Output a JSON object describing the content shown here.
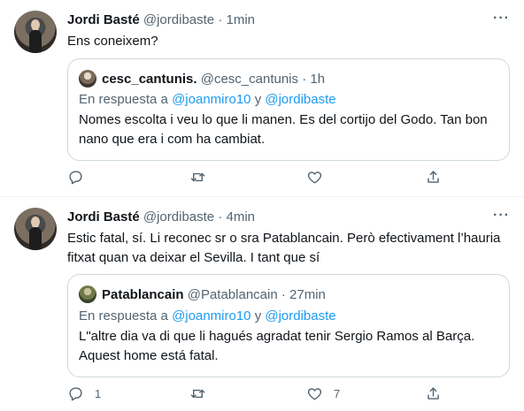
{
  "tweets": [
    {
      "name": "Jordi Basté",
      "handle": "@jordibaste",
      "sep": "·",
      "time": "1min",
      "text": "Ens coneixem?",
      "more": "···",
      "quote": {
        "name": "cesc_cantunis.",
        "handle": "@cesc_cantunis",
        "sep": "·",
        "time": "1h",
        "reply_prefix": "En respuesta a",
        "reply_user1": "@joanmiro10",
        "reply_and": "y",
        "reply_user2": "@jordibaste",
        "text": "Nomes escolta i veu lo que li manen. Es del cortijo del Godo. Tan bon nano que era i com ha cambiat."
      },
      "actions": {
        "reply_count": "",
        "retweet_count": "",
        "like_count": ""
      }
    },
    {
      "name": "Jordi Basté",
      "handle": "@jordibaste",
      "sep": "·",
      "time": "4min",
      "text": "Estic fatal, sí. Li reconec sr o sra Patablancain. Però efectivament l’hauria fitxat quan va deixar el Sevilla. I tant que sí",
      "more": "···",
      "quote": {
        "name": "Patablancain",
        "handle": "@Patablancain",
        "sep": "·",
        "time": "27min",
        "reply_prefix": "En respuesta a",
        "reply_user1": "@joanmiro10",
        "reply_and": "y",
        "reply_user2": "@jordibaste",
        "text": "L\"altre dia va di que li hagués agradat tenir Sergio Ramos al Barça. Aquest home está fatal."
      },
      "actions": {
        "reply_count": "1",
        "retweet_count": "",
        "like_count": "7"
      }
    }
  ],
  "colors": {
    "text": "#0f1419",
    "muted": "#536471",
    "link": "#1d9bf0",
    "border": "#cfd9de"
  },
  "icons": [
    "reply-icon",
    "retweet-icon",
    "like-icon",
    "share-icon",
    "more-icon"
  ]
}
